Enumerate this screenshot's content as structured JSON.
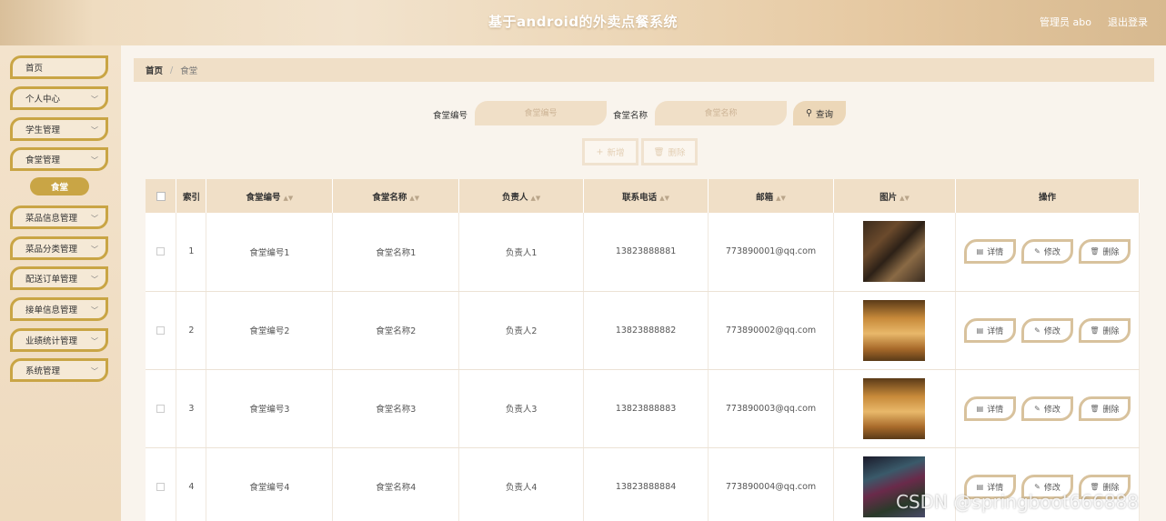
{
  "header": {
    "title": "基于android的外卖点餐系统",
    "user_label": "管理员 abo",
    "logout_label": "退出登录"
  },
  "sidebar": {
    "items": [
      {
        "label": "首页",
        "chevron": false
      },
      {
        "label": "个人中心",
        "chevron": true
      },
      {
        "label": "学生管理",
        "chevron": true
      },
      {
        "label": "食堂管理",
        "chevron": true
      },
      {
        "label": "菜品信息管理",
        "chevron": true
      },
      {
        "label": "菜品分类管理",
        "chevron": true
      },
      {
        "label": "配送订单管理",
        "chevron": true
      },
      {
        "label": "接单信息管理",
        "chevron": true
      },
      {
        "label": "业绩统计管理",
        "chevron": true
      },
      {
        "label": "系统管理",
        "chevron": true
      }
    ],
    "active_sub": "食堂"
  },
  "breadcrumb": {
    "home": "首页",
    "current": "食堂"
  },
  "search": {
    "code_label": "食堂编号",
    "code_placeholder": "食堂编号",
    "name_label": "食堂名称",
    "name_placeholder": "食堂名称",
    "button_label": "查询"
  },
  "actions": {
    "add_label": "新增",
    "delete_label": "删除"
  },
  "table": {
    "headers": [
      "索引",
      "食堂编号",
      "食堂名称",
      "负责人",
      "联系电话",
      "邮箱",
      "图片",
      "操作"
    ],
    "rows": [
      {
        "index": "1",
        "code": "食堂编号1",
        "name": "食堂名称1",
        "manager": "负责人1",
        "phone": "13823888881",
        "email": "773890001@qq.com",
        "image": "canteen-photo-1"
      },
      {
        "index": "2",
        "code": "食堂编号2",
        "name": "食堂名称2",
        "manager": "负责人2",
        "phone": "13823888882",
        "email": "773890002@qq.com",
        "image": "canteen-photo-2"
      },
      {
        "index": "3",
        "code": "食堂编号3",
        "name": "食堂名称3",
        "manager": "负责人3",
        "phone": "13823888883",
        "email": "773890003@qq.com",
        "image": "canteen-photo-3"
      },
      {
        "index": "4",
        "code": "食堂编号4",
        "name": "食堂名称4",
        "manager": "负责人4",
        "phone": "13823888884",
        "email": "773890004@qq.com",
        "image": "canteen-photo-4"
      }
    ],
    "op_labels": {
      "detail": "详情",
      "edit": "修改",
      "delete": "删除"
    }
  },
  "watermark": "CSDN @springboot666888",
  "colors": {
    "accent": "#c9a545",
    "header_bg": "#ecd6b6",
    "table_header": "#f0dfc7"
  }
}
